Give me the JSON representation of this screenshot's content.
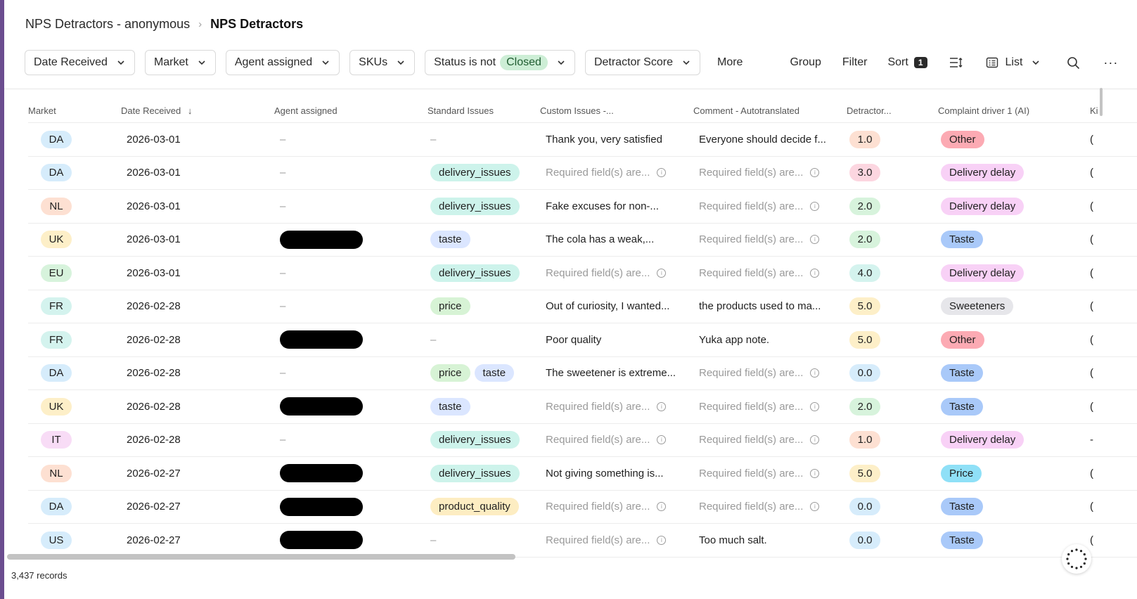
{
  "breadcrumb": {
    "parent": "NPS Detractors - anonymous",
    "current": "NPS Detractors"
  },
  "toolbar": {
    "filters": [
      "Date Received",
      "Market",
      "Agent assigned",
      "SKUs"
    ],
    "status_prefix": "Status is not",
    "status_value": "Closed",
    "score_filter": "Detractor Score",
    "more": "More",
    "group": "Group",
    "filter": "Filter",
    "sort": "Sort",
    "sort_count": "1",
    "view": "List"
  },
  "columns": {
    "market": "Market",
    "date": "Date Received",
    "agent": "Agent assigned",
    "std": "Standard Issues",
    "custom": "Custom Issues -...",
    "comment": "Comment - Autotranslated",
    "score": "Detractor...",
    "complaint": "Complaint driver 1 (AI)",
    "extra": "Ki"
  },
  "colors": {
    "DA": "#d6ecfb",
    "NL": "#fde0d2",
    "UK": "#fdefc8",
    "EU": "#d7f3dc",
    "FR": "#d4f3ee",
    "IT": "#f8dcf6",
    "US": "#d6ecfb",
    "delivery_issues": "#cdf3eb",
    "taste": "#dbe6ff",
    "price": "#d7f3d5",
    "product_quality": "#fdedc2",
    "Other": "#fcaab3",
    "Delivery delay": "#f8d1f6",
    "Taste": "#a9c9f9",
    "Sweeteners": "#e6e6ea",
    "Price": "#8fe0f7"
  },
  "rows": [
    {
      "market": "DA",
      "date": "2026-03-01",
      "agent": "–",
      "std": [],
      "custom": "Thank you, very satisfied",
      "comment": "Everyone should decide f...",
      "score": "1.0",
      "complaint": "Other",
      "extra": "("
    },
    {
      "market": "DA",
      "date": "2026-03-01",
      "agent": "–",
      "std": [
        "delivery_issues"
      ],
      "custom": "Required field(s) are...",
      "comment": "Required field(s) are...",
      "score": "3.0",
      "complaint": "Delivery delay",
      "extra": "("
    },
    {
      "market": "NL",
      "date": "2026-03-01",
      "agent": "–",
      "std": [
        "delivery_issues"
      ],
      "custom": "Fake excuses for non-...",
      "comment": "Required field(s) are...",
      "score": "2.0",
      "complaint": "Delivery delay",
      "extra": "("
    },
    {
      "market": "UK",
      "date": "2026-03-01",
      "agent": "",
      "std": [
        "taste"
      ],
      "custom": "The cola has a weak,...",
      "comment": "Required field(s) are...",
      "score": "2.0",
      "complaint": "Taste",
      "extra": "("
    },
    {
      "market": "EU",
      "date": "2026-03-01",
      "agent": "–",
      "std": [
        "delivery_issues"
      ],
      "custom": "Required field(s) are...",
      "comment": "Required field(s) are...",
      "score": "4.0",
      "complaint": "Delivery delay",
      "extra": "("
    },
    {
      "market": "FR",
      "date": "2026-02-28",
      "agent": "–",
      "std": [
        "price"
      ],
      "custom": "Out of curiosity, I wanted...",
      "comment": "the products used to ma...",
      "score": "5.0",
      "complaint": "Sweeteners",
      "extra": "("
    },
    {
      "market": "FR",
      "date": "2026-02-28",
      "agent": "",
      "std": [],
      "custom": "Poor quality",
      "comment": "Yuka app note.",
      "score": "5.0",
      "complaint": "Other",
      "extra": "("
    },
    {
      "market": "DA",
      "date": "2026-02-28",
      "agent": "–",
      "std": [
        "price",
        "taste"
      ],
      "custom": "The sweetener is extreme...",
      "comment": "Required field(s) are...",
      "score": "0.0",
      "complaint": "Taste",
      "extra": "("
    },
    {
      "market": "UK",
      "date": "2026-02-28",
      "agent": "",
      "std": [
        "taste"
      ],
      "custom": "Required field(s) are...",
      "comment": "Required field(s) are...",
      "score": "2.0",
      "complaint": "Taste",
      "extra": "("
    },
    {
      "market": "IT",
      "date": "2026-02-28",
      "agent": "–",
      "std": [
        "delivery_issues"
      ],
      "custom": "Required field(s) are...",
      "comment": "Required field(s) are...",
      "score": "1.0",
      "complaint": "Delivery delay",
      "extra": "-"
    },
    {
      "market": "NL",
      "date": "2026-02-27",
      "agent": "",
      "std": [
        "delivery_issues"
      ],
      "custom": "Not giving something is...",
      "comment": "Required field(s) are...",
      "score": "5.0",
      "complaint": "Price",
      "extra": "("
    },
    {
      "market": "DA",
      "date": "2026-02-27",
      "agent": "",
      "std": [
        "product_quality"
      ],
      "custom": "Required field(s) are...",
      "comment": "Required field(s) are...",
      "score": "0.0",
      "complaint": "Taste",
      "extra": "("
    },
    {
      "market": "US",
      "date": "2026-02-27",
      "agent": "",
      "std": [],
      "custom": "Required field(s) are...",
      "comment": "Too much salt.",
      "score": "0.0",
      "complaint": "Taste",
      "extra": "("
    }
  ],
  "score_colors": {
    "0.0": "#d6ecfb",
    "1.0": "#fde0d2",
    "2.0": "#d7f3dc",
    "3.0": "#fcd6e0",
    "4.0": "#d4f3ee",
    "5.0": "#fdefc8"
  },
  "footer": {
    "records": "3,437 records"
  }
}
